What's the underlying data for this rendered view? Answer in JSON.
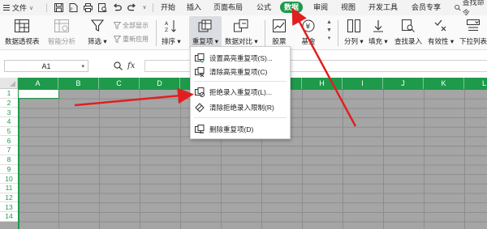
{
  "menubar": {
    "file_label": "文件",
    "tabs": [
      "开始",
      "插入",
      "页面布局",
      "公式",
      "数据",
      "审阅",
      "视图",
      "开发工具",
      "会员专享"
    ],
    "active_tab": "数据",
    "search_label": "查找命令"
  },
  "ribbon": {
    "pivot_table": "数据透视表",
    "smart_analysis": "智能分析",
    "filter": "筛选",
    "show_all": "全部显示",
    "reapply": "重新应用",
    "sort": "排序",
    "duplicates": "重复项",
    "compare": "数据对比",
    "stocks": "股票",
    "fund": "基金",
    "split": "分列",
    "fill": "填充",
    "lookup_entry": "查找录入",
    "validity": "有效性",
    "dropdown_list": "下拉列表"
  },
  "formula_bar": {
    "cell_ref": "A1",
    "fx_label": "fx",
    "formula_value": ""
  },
  "sheet": {
    "columns": [
      "A",
      "B",
      "C",
      "D",
      "E",
      "F",
      "G",
      "H",
      "I",
      "J",
      "K",
      "L"
    ],
    "rows": [
      "1",
      "2",
      "3",
      "4",
      "5",
      "6",
      "7",
      "8",
      "9",
      "10",
      "11",
      "12",
      "13",
      "14"
    ]
  },
  "duplicates_menu": {
    "items": [
      {
        "label": "设置高亮重复项(S)...",
        "icon": "highlight-duplicates-icon"
      },
      {
        "label": "清除高亮重复项(C)",
        "icon": "clear-highlight-icon"
      },
      {
        "label": "拒绝录入重复项(L)...",
        "icon": "reject-duplicates-icon"
      },
      {
        "label": "清除拒绝录入限制(R)",
        "icon": "clear-restriction-icon"
      },
      {
        "label": "删除重复项(D)",
        "icon": "delete-duplicates-icon"
      }
    ]
  },
  "colors": {
    "accent_green": "#1e9a4a",
    "arrow_red": "#e02020",
    "sheet_fill": "#a5a5a5"
  }
}
